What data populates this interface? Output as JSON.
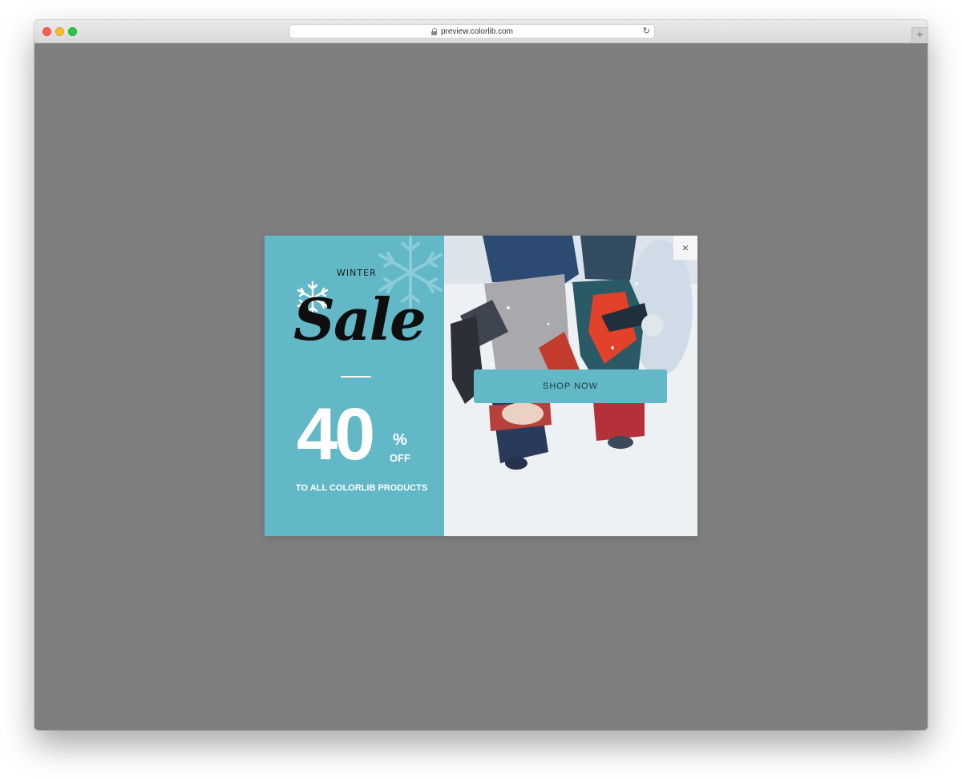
{
  "browser": {
    "url": "preview.colorlib.com",
    "new_tab_label": "+",
    "reload_icon": "reload-icon",
    "lock_icon": "lock-icon"
  },
  "popup": {
    "eyebrow": "WINTER",
    "title": "Sale",
    "discount_value": "40",
    "discount_unit": "%",
    "discount_suffix": "OFF",
    "subtitle": "TO ALL COLORLIB PRODUCTS",
    "cta_label": "SHOP NOW",
    "close_label": "×",
    "colors": {
      "panel": "#62b8c6",
      "title": "#0e0e0e",
      "text_light": "#ffffff",
      "overlay": "#7f7f7f"
    }
  }
}
